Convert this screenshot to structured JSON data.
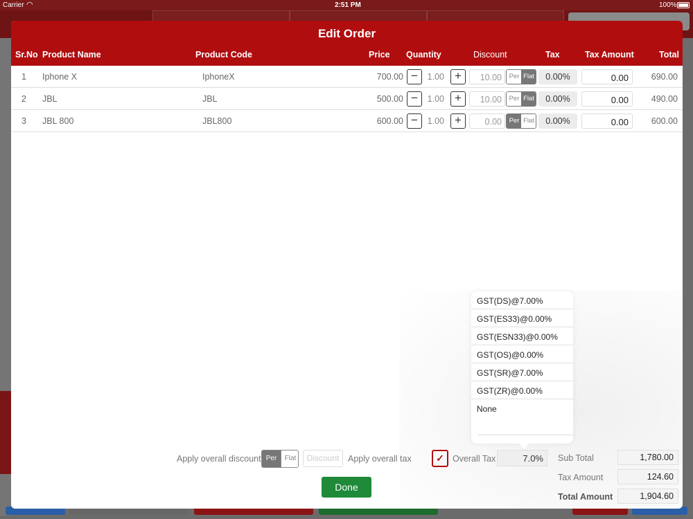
{
  "status_bar": {
    "carrier": "Carrier",
    "time": "2:51 PM",
    "battery": "100%"
  },
  "modal": {
    "title": "Edit Order",
    "columns": {
      "srno": "Sr.No",
      "product_name": "Product Name",
      "product_code": "Product Code",
      "price": "Price",
      "quantity": "Quantity",
      "discount": "Discount",
      "tax": "Tax",
      "tax_amount": "Tax Amount",
      "total": "Total"
    },
    "rows": [
      {
        "srno": "1",
        "name": "Iphone X",
        "code": "IphoneX",
        "price": "700.00",
        "qty": "1.00",
        "discount": "10.00",
        "mode_per": "Per",
        "mode_flat": "Flat",
        "active_mode": "flat",
        "tax": "0.00%",
        "tax_amount": "0.00",
        "total": "690.00"
      },
      {
        "srno": "2",
        "name": "JBL",
        "code": "JBL",
        "price": "500.00",
        "qty": "1.00",
        "discount": "10.00",
        "mode_per": "Per",
        "mode_flat": "Flat",
        "active_mode": "flat",
        "tax": "0.00%",
        "tax_amount": "0.00",
        "total": "490.00"
      },
      {
        "srno": "3",
        "name": "JBL 800",
        "code": "JBL800",
        "price": "600.00",
        "qty": "1.00",
        "discount": "0.00",
        "mode_per": "Per",
        "mode_flat": "Flat",
        "active_mode": "per",
        "tax": "0.00%",
        "tax_amount": "0.00",
        "total": "600.00"
      }
    ],
    "tax_options": [
      "GST(DS)@7.00%",
      "GST(ES33)@0.00%",
      "GST(ESN33)@0.00%",
      "GST(OS)@0.00%",
      "GST(SR)@7.00%",
      "GST(ZR)@0.00%",
      "None"
    ],
    "footer": {
      "apply_overall_discount": "Apply overall discount",
      "seg_per": "Per",
      "seg_flat": "Flat",
      "discount_placeholder": "Discount",
      "apply_overall_tax": "Apply overall tax",
      "overall_tax_label": "Overall Tax",
      "overall_tax_value": "7.0%",
      "sub_total_label": "Sub Total",
      "sub_total": "1,780.00",
      "tax_amount_label": "Tax Amount",
      "tax_amount": "124.60",
      "total_amount_label": "Total Amount",
      "total_amount": "1,904.60",
      "done": "Done"
    }
  },
  "colors": {
    "accent_red": "#b00d0f",
    "done_green": "#1e8a3a",
    "segment_active": "#777777"
  }
}
